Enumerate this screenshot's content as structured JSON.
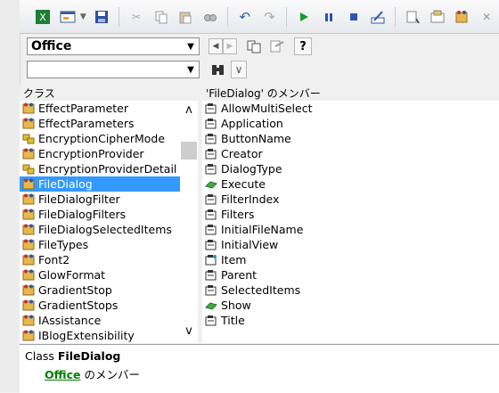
{
  "toolbar": {
    "buttons": [
      "excel-icon",
      "userform-icon",
      "dropdown-arrow-icon",
      "save-icon",
      "cut-icon",
      "copy-icon",
      "paste-icon",
      "find-icon",
      "undo-icon",
      "redo-icon",
      "run-icon",
      "pause-icon",
      "stop-icon",
      "design-mode-icon",
      "project-explorer-icon",
      "properties-icon",
      "object-browser-icon",
      "toolbox-icon"
    ]
  },
  "library": {
    "selected": "Office"
  },
  "search": {
    "value": ""
  },
  "classes": {
    "header": "クラス",
    "items": [
      {
        "label": "EffectParameter",
        "icon": "class"
      },
      {
        "label": "EffectParameters",
        "icon": "class"
      },
      {
        "label": "EncryptionCipherMode",
        "icon": "enum"
      },
      {
        "label": "EncryptionProvider",
        "icon": "class"
      },
      {
        "label": "EncryptionProviderDetail",
        "icon": "enum"
      },
      {
        "label": "FileDialog",
        "icon": "class",
        "selected": true
      },
      {
        "label": "FileDialogFilter",
        "icon": "class"
      },
      {
        "label": "FileDialogFilters",
        "icon": "class"
      },
      {
        "label": "FileDialogSelectedItems",
        "icon": "class"
      },
      {
        "label": "FileTypes",
        "icon": "class"
      },
      {
        "label": "Font2",
        "icon": "class"
      },
      {
        "label": "GlowFormat",
        "icon": "class"
      },
      {
        "label": "GradientStop",
        "icon": "class"
      },
      {
        "label": "GradientStops",
        "icon": "class"
      },
      {
        "label": "IAssistance",
        "icon": "class"
      },
      {
        "label": "IBlogExtensibility",
        "icon": "class"
      }
    ]
  },
  "members": {
    "header": "'FileDialog' のメンバー",
    "items": [
      {
        "label": "AllowMultiSelect",
        "icon": "property"
      },
      {
        "label": "Application",
        "icon": "property"
      },
      {
        "label": "ButtonName",
        "icon": "property"
      },
      {
        "label": "Creator",
        "icon": "property"
      },
      {
        "label": "DialogType",
        "icon": "property"
      },
      {
        "label": "Execute",
        "icon": "method"
      },
      {
        "label": "FilterIndex",
        "icon": "property"
      },
      {
        "label": "Filters",
        "icon": "property"
      },
      {
        "label": "InitialFileName",
        "icon": "property"
      },
      {
        "label": "InitialView",
        "icon": "property"
      },
      {
        "label": "Item",
        "icon": "default-property"
      },
      {
        "label": "Parent",
        "icon": "property"
      },
      {
        "label": "SelectedItems",
        "icon": "property"
      },
      {
        "label": "Show",
        "icon": "method"
      },
      {
        "label": "Title",
        "icon": "property"
      }
    ]
  },
  "detail": {
    "kind": "Class",
    "name": "FileDialog",
    "link": "Office",
    "suffix": "のメンバー"
  },
  "colors": {
    "selection": "#3399ff",
    "link": "#008000"
  }
}
